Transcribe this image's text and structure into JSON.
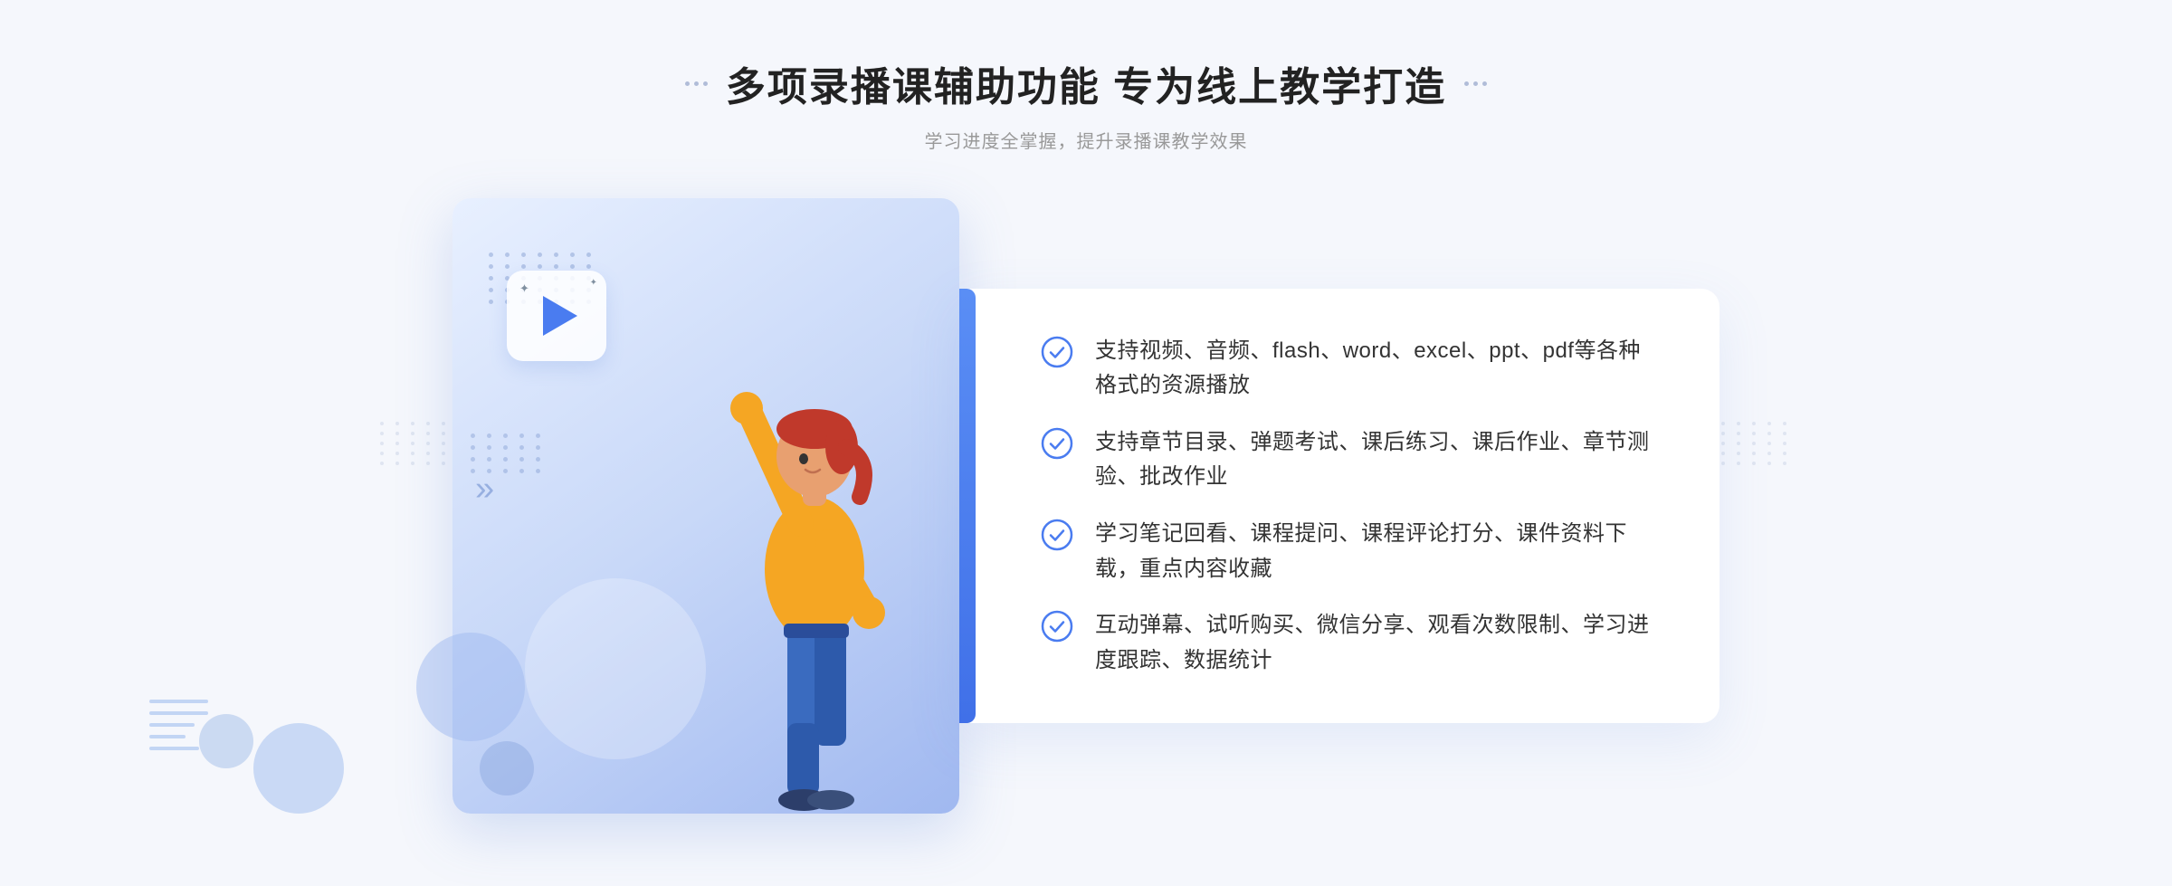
{
  "header": {
    "title": "多项录播课辅助功能 专为线上教学打造",
    "subtitle": "学习进度全掌握，提升录播课教学效果",
    "deco_dots_count": 6
  },
  "features": [
    {
      "id": 1,
      "text": "支持视频、音频、flash、word、excel、ppt、pdf等各种格式的资源播放"
    },
    {
      "id": 2,
      "text": "支持章节目录、弹题考试、课后练习、课后作业、章节测验、批改作业"
    },
    {
      "id": 3,
      "text": "学习笔记回看、课程提问、课程评论打分、课件资料下载，重点内容收藏"
    },
    {
      "id": 4,
      "text": "互动弹幕、试听购买、微信分享、观看次数限制、学习进度跟踪、数据统计"
    }
  ],
  "colors": {
    "accent_blue": "#4a7cf0",
    "light_blue": "#e8f0ff",
    "title_color": "#222222",
    "subtitle_color": "#999999",
    "text_color": "#333333"
  },
  "icons": {
    "check": "check-circle",
    "play": "play-button",
    "chevrons": "double-arrow-right"
  }
}
